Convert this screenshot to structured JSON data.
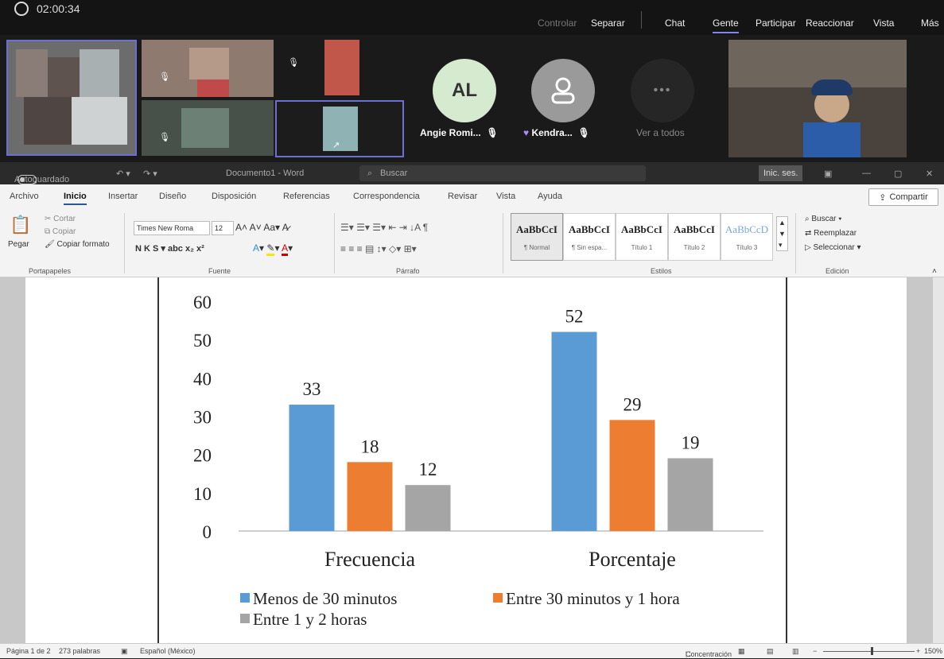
{
  "teams": {
    "timer": "02:00:34",
    "toolbar": [
      {
        "label": "Controlar",
        "muted": true
      },
      {
        "label": "Separar"
      },
      {
        "label": "Chat"
      },
      {
        "label": "Gente",
        "active": true
      },
      {
        "label": "Participar"
      },
      {
        "label": "Reaccionar"
      },
      {
        "label": "Vista"
      },
      {
        "label": "Más"
      }
    ],
    "participants": {
      "angie": {
        "initials": "AL",
        "name": "Angie Romi..."
      },
      "kendra": {
        "name": "Kendra..."
      },
      "see_all": "Ver a todos"
    }
  },
  "word": {
    "title_bar": {
      "autosave": "Autoguardado",
      "doc_title": "Documento1 - Word",
      "search": "Buscar",
      "signin": "Inic. ses."
    },
    "tabs": [
      "Archivo",
      "Inicio",
      "Insertar",
      "Diseño",
      "Disposición",
      "Referencias",
      "Correspondencia",
      "Revisar",
      "Vista",
      "Ayuda"
    ],
    "active_tab": "Inicio",
    "share": "Compartir",
    "clipboard": {
      "paste": "Pegar",
      "cut": "Cortar",
      "copy": "Copiar",
      "format": "Copiar formato",
      "label": "Portapapeles"
    },
    "font": {
      "name": "Times New Roma",
      "size": "12",
      "label": "Fuente"
    },
    "paragraph": {
      "label": "Párrafo"
    },
    "styles": {
      "label": "Estilos",
      "items": [
        {
          "sample": "AaBbCcI",
          "name": "¶ Normal"
        },
        {
          "sample": "AaBbCcI",
          "name": "¶ Sin espa..."
        },
        {
          "sample": "AaBbCcI",
          "name": "Título 1"
        },
        {
          "sample": "AaBbCcI",
          "name": "Título 2"
        },
        {
          "sample": "AaBbCcD",
          "name": "Título 3"
        }
      ]
    },
    "editing": {
      "find": "Buscar",
      "replace": "Reemplazar",
      "select": "Seleccionar",
      "label": "Edición"
    },
    "status": {
      "page": "Página 1 de 2",
      "words": "273 palabras",
      "language": "Español (México)",
      "focus": "Concentración",
      "zoom": "150%"
    }
  },
  "colors": {
    "blue": "#5b9bd5",
    "orange": "#ed7d31",
    "gray": "#a5a5a5"
  },
  "chart_data": {
    "type": "bar",
    "categories": [
      "Frecuencia",
      "Porcentaje"
    ],
    "series": [
      {
        "name": "Menos de 30 minutos",
        "values": [
          33,
          52
        ]
      },
      {
        "name": "Entre 30 minutos y 1 hora",
        "values": [
          18,
          29
        ]
      },
      {
        "name": "Entre 1 y 2 horas",
        "values": [
          12,
          19
        ]
      }
    ],
    "ylim": [
      0,
      60
    ],
    "yticks": [
      0,
      10,
      20,
      30,
      40,
      50,
      60
    ],
    "legend": "bottom",
    "grid": false
  }
}
